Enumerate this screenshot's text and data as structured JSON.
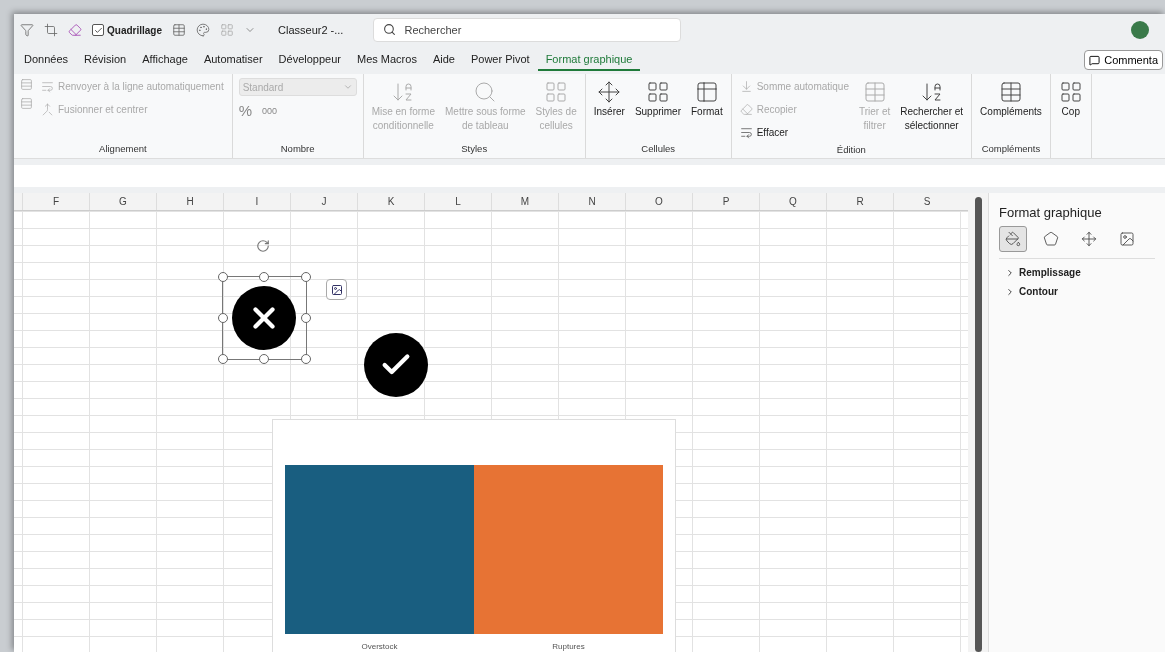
{
  "title_bar": {
    "gridlines": {
      "label": "Quadrillage",
      "checked": true
    },
    "document_title": "Classeur2 -...",
    "search": {
      "placeholder": "Rechercher"
    }
  },
  "tabs": [
    {
      "label": "Données",
      "selected": false
    },
    {
      "label": "Révision",
      "selected": false
    },
    {
      "label": "Affichage",
      "selected": false
    },
    {
      "label": "Automatiser",
      "selected": false
    },
    {
      "label": "Développeur",
      "selected": false
    },
    {
      "label": "Mes Macros",
      "selected": false
    },
    {
      "label": "Aide",
      "selected": false
    },
    {
      "label": "Power Pivot",
      "selected": false
    },
    {
      "label": "Format graphique",
      "selected": true
    }
  ],
  "comment_button": "Commenta",
  "ribbon": [
    {
      "name": "Alignement",
      "controls": [
        {
          "kind": "small",
          "label": "Renvoyer à la ligne automatiquement",
          "disabled": true
        },
        {
          "kind": "small",
          "label": "Fusionner et centrer",
          "disabled": true
        }
      ]
    },
    {
      "name": "Nombre",
      "controls": [
        {
          "kind": "dropdown",
          "label": "Standard",
          "disabled": true
        },
        {
          "kind": "symbol",
          "label": "%",
          "disabled": true
        },
        {
          "kind": "symbol",
          "label": "000",
          "disabled": true
        }
      ]
    },
    {
      "name": "Styles",
      "controls": [
        {
          "kind": "large",
          "lines": [
            "Mise en forme",
            "conditionnelle"
          ],
          "disabled": true
        },
        {
          "kind": "large",
          "lines": [
            "Mettre sous forme",
            "de tableau"
          ],
          "disabled": true
        },
        {
          "kind": "large",
          "lines": [
            "Styles de",
            "cellules"
          ],
          "disabled": true
        }
      ]
    },
    {
      "name": "Cellules",
      "controls": [
        {
          "kind": "large",
          "lines": [
            "Insérer"
          ],
          "disabled": false
        },
        {
          "kind": "large",
          "lines": [
            "Supprimer"
          ],
          "disabled": false
        },
        {
          "kind": "large",
          "lines": [
            "Format"
          ],
          "disabled": false
        }
      ]
    },
    {
      "name": "Édition",
      "controls": [
        {
          "kind": "small",
          "label": "Somme automatique",
          "disabled": true
        },
        {
          "kind": "small",
          "label": "Recopier",
          "disabled": true
        },
        {
          "kind": "small",
          "label": "Effacer",
          "disabled": false
        },
        {
          "kind": "large",
          "lines": [
            "Trier et",
            "filtrer"
          ],
          "disabled": true
        },
        {
          "kind": "large",
          "lines": [
            "Rechercher et",
            "sélectionner"
          ],
          "disabled": false
        }
      ]
    },
    {
      "name": "Compléments",
      "controls": [
        {
          "kind": "large",
          "lines": [
            "Compléments"
          ],
          "disabled": false
        }
      ]
    },
    {
      "controls": [
        {
          "kind": "large",
          "lines": [
            "Cop"
          ],
          "disabled": false
        }
      ]
    }
  ],
  "columns": [
    "F",
    "G",
    "H",
    "I",
    "J",
    "K",
    "L",
    "M",
    "N",
    "O",
    "P",
    "Q",
    "R",
    "S"
  ],
  "chart": {
    "bars": [
      {
        "label": "Overstock",
        "color": "#195e80"
      },
      {
        "label": "Ruptures",
        "color": "#e77334"
      }
    ]
  },
  "panel": {
    "title": "Format graphique",
    "icon_tabs": [
      {
        "selected": true
      },
      {
        "selected": false
      },
      {
        "selected": false
      },
      {
        "selected": false
      }
    ],
    "sections": [
      {
        "label": "Remplissage",
        "expanded": false
      },
      {
        "label": "Contour",
        "expanded": false
      }
    ]
  }
}
